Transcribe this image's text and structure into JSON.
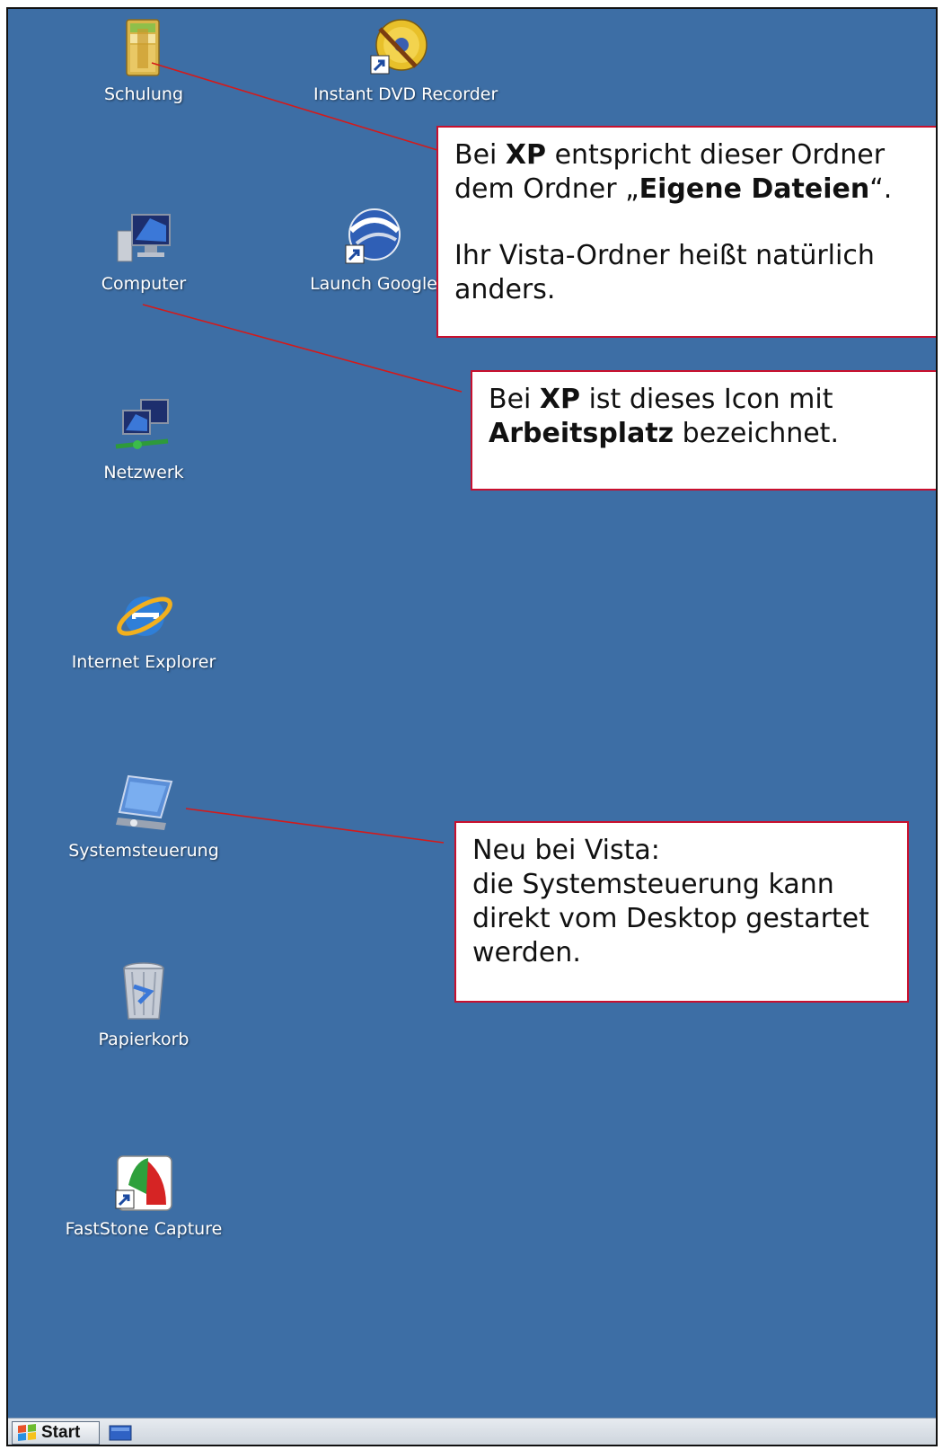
{
  "desktop": {
    "background_color": "#3d6ea5",
    "icons": [
      {
        "label": "Schulung",
        "icon": "folder-icon"
      },
      {
        "label": "Instant DVD Recorder",
        "icon": "dvd-recorder-icon"
      },
      {
        "label": "Computer",
        "icon": "computer-icon"
      },
      {
        "label": "Launch Google",
        "icon": "google-earth-icon"
      },
      {
        "label": "Netzwerk",
        "icon": "network-icon"
      },
      {
        "label": "Internet Explorer",
        "icon": "internet-explorer-icon"
      },
      {
        "label": "Systemsteuerung",
        "icon": "control-panel-icon"
      },
      {
        "label": "Papierkorb",
        "icon": "recycle-bin-icon"
      },
      {
        "label": "FastStone Capture",
        "icon": "faststone-capture-icon"
      }
    ]
  },
  "callouts": {
    "folder": {
      "l1_pre": "Bei ",
      "l1_bold": "XP",
      "l1_post": " entspricht dieser Ordner",
      "l2_pre": "dem Ordner „",
      "l2_bold": "Eigene Dateien",
      "l2_post": "“.",
      "p2_l1": "Ihr Vista-Ordner heißt natürlich",
      "p2_l2": "anders."
    },
    "computer": {
      "l1_pre": "Bei ",
      "l1_bold": "XP",
      "l1_post": " ist dieses Icon mit",
      "l2_bold": "Arbeitsplatz",
      "l2_post": " bezeichnet."
    },
    "control_panel": {
      "l1": "Neu bei Vista:",
      "l2": "die Systemsteuerung kann",
      "l3": "direkt vom Desktop gestartet",
      "l4": "werden."
    },
    "border_color": "#c8102e"
  },
  "taskbar": {
    "start_label": "Start"
  }
}
